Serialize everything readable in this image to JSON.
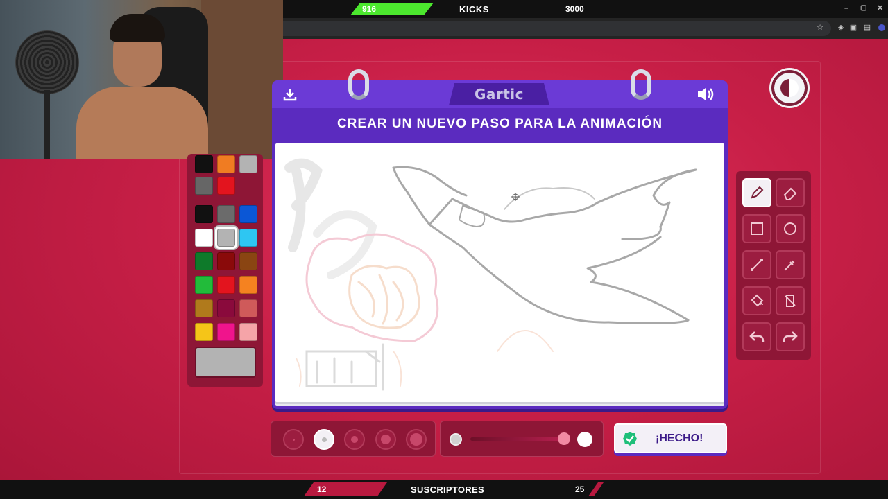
{
  "top_bar": {
    "kicks_current": "916",
    "kicks_label": "KICKS",
    "kicks_goal": "3000",
    "kicks_progress_fraction": 0.305,
    "progress_color": "#4ce82e"
  },
  "game": {
    "logo": "Gartic",
    "step_title": "CREAR UN NUEVO PASO PARA LA ANIMACIÓN",
    "done_label": "¡HECHO!",
    "header_color": "#5b2bbf"
  },
  "palette": {
    "colors": [
      "#111111",
      "#f07c22",
      "#b3b3b3",
      "#666666",
      "#e3141e",
      "#111111",
      "#6b6b6b",
      "#0b57d6",
      "#ffffff",
      "#b3b3b3",
      "#2ec6f2",
      "#0e7a2a",
      "#8a0a0a",
      "#8a4512",
      "#22bb3a",
      "#e3141e",
      "#f58220",
      "#b07a1c",
      "#8a0a3c",
      "#cf5a5a",
      "#f5c518",
      "#f0148c",
      "#f5a4a8"
    ],
    "selected_color": "#b3b3b3"
  },
  "tools": [
    "pencil-icon",
    "eraser-icon",
    "rectangle-icon",
    "circle-icon",
    "line-icon",
    "eyedropper-icon",
    "fill-icon",
    "clear-icon",
    "undo-icon",
    "redo-icon"
  ],
  "active_tool": "pencil-icon",
  "brush_sizes": {
    "count": 5,
    "selected_index": 1
  },
  "opacity": {
    "level": 0.9
  },
  "bottom_bar": {
    "subs_current": "12",
    "subs_label": "SUSCRIPTORES",
    "subs_goal": "25",
    "progress_color": "#b8193f"
  },
  "accent": "#c81f47"
}
